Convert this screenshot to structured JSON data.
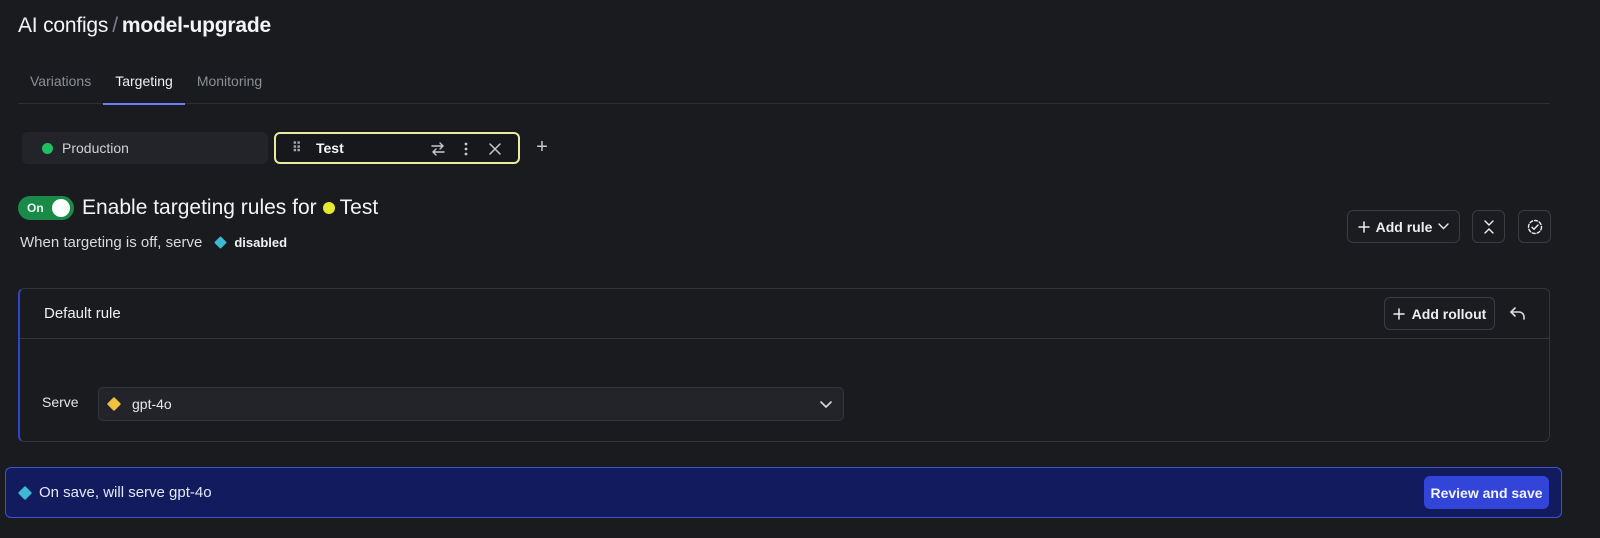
{
  "header": {
    "parent": "AI configs",
    "separator": "/",
    "current": "model-upgrade"
  },
  "tabs": [
    {
      "label": "Variations",
      "active": false
    },
    {
      "label": "Targeting",
      "active": true
    },
    {
      "label": "Monitoring",
      "active": false
    }
  ],
  "environments": [
    {
      "name": "Production",
      "color": "#1fbf62",
      "selected": false
    },
    {
      "name": "Test",
      "color": "#e3ea30",
      "selected": true
    }
  ],
  "targeting": {
    "toggle_label": "On",
    "toggle_state": true,
    "enable_text": "Enable targeting rules for",
    "environment": "Test",
    "off_serve_text": "When targeting is off, serve",
    "off_variation": "disabled",
    "off_variation_color": "#3cbad3"
  },
  "toolbar": {
    "add_rule_label": "Add rule"
  },
  "default_rule": {
    "title": "Default rule",
    "add_rollout_label": "Add rollout",
    "serve_label": "Serve",
    "serve_value": "gpt-4o",
    "serve_color": "#f0c13e"
  },
  "savebar": {
    "message": "On save, will serve gpt-4o",
    "button_label": "Review and save"
  }
}
